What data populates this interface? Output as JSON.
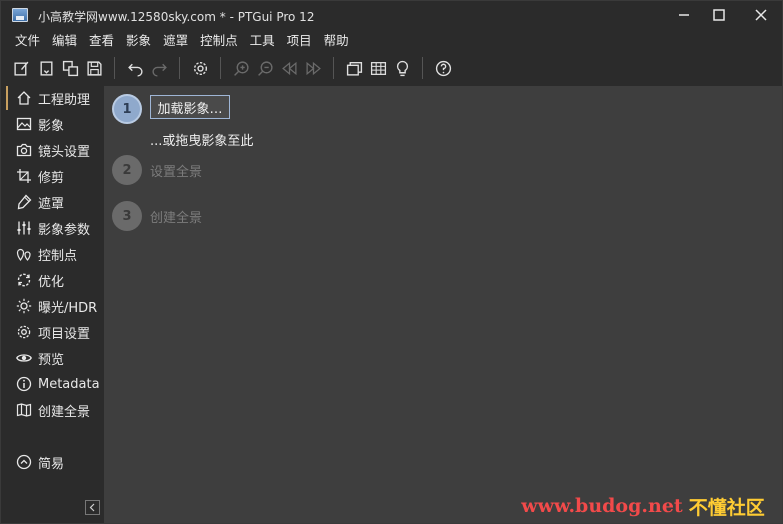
{
  "window": {
    "title": "小高教学网www.12580sky.com * - PTGui Pro 12"
  },
  "menu": [
    "文件",
    "编辑",
    "查看",
    "影象",
    "遮罩",
    "控制点",
    "工具",
    "项目",
    "帮助"
  ],
  "toolbar_icons": [
    "new-project-icon",
    "open-project-icon",
    "copy-icon",
    "save-icon",
    "undo-icon",
    "redo-icon",
    "settings-icon",
    "zoom-in-icon",
    "zoom-out-icon",
    "rewind-icon",
    "forward-icon",
    "panorama-editor-icon",
    "table-icon",
    "lightbulb-icon",
    "help-icon"
  ],
  "sidebar": {
    "items": [
      {
        "label": "工程助理",
        "icon": "home-icon",
        "active": true
      },
      {
        "label": "影象",
        "icon": "image-icon"
      },
      {
        "label": "镜头设置",
        "icon": "camera-icon"
      },
      {
        "label": "修剪",
        "icon": "crop-icon"
      },
      {
        "label": "遮罩",
        "icon": "mask-icon"
      },
      {
        "label": "影象参数",
        "icon": "sliders-icon"
      },
      {
        "label": "控制点",
        "icon": "control-points-icon"
      },
      {
        "label": "优化",
        "icon": "optimize-icon"
      },
      {
        "label": "曝光/HDR",
        "icon": "exposure-icon"
      },
      {
        "label": "项目设置",
        "icon": "gear-icon"
      },
      {
        "label": "预览",
        "icon": "eye-icon"
      },
      {
        "label": "Metadata",
        "icon": "info-icon"
      },
      {
        "label": "创建全景",
        "icon": "map-icon"
      }
    ],
    "simple_mode": "简易"
  },
  "assistant": {
    "steps": [
      {
        "number": "1",
        "button_label": "加载影象…",
        "hint": "...或拖曳影象至此"
      },
      {
        "number": "2",
        "label": "设置全景"
      },
      {
        "number": "3",
        "label": "创建全景"
      }
    ]
  },
  "watermark": {
    "url": "www.budog.net",
    "brand": "不懂社区"
  },
  "colors": {
    "background": "#2b2b2b",
    "panel": "#3e3e3e",
    "step_active": "#8fa9cc",
    "accent_border": "#9fb6d6",
    "watermark_red": "#f24a4a",
    "watermark_yellow": "#ffcc33"
  }
}
